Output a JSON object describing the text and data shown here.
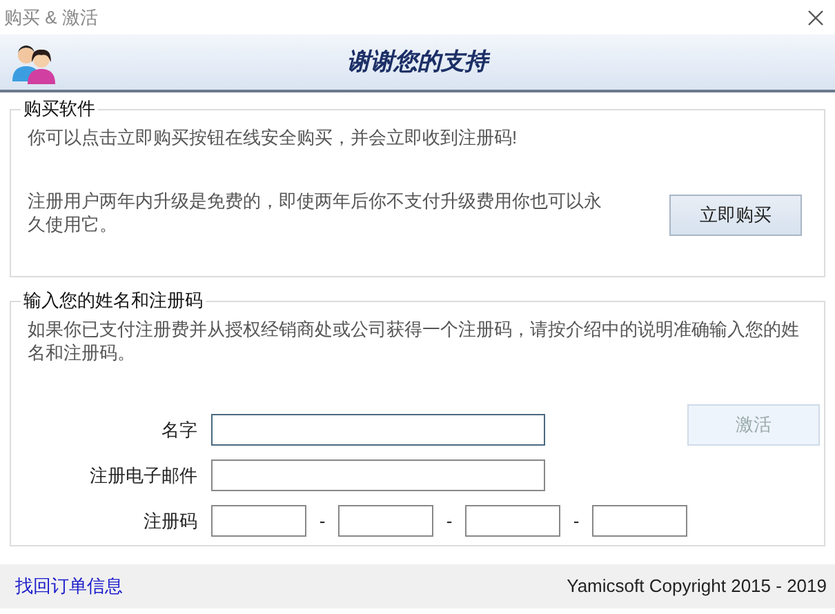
{
  "window": {
    "title": "购买 & 激活"
  },
  "header": {
    "title": "谢谢您的支持"
  },
  "buy_group": {
    "legend": "购买软件",
    "text_1": "你可以点击立即购买按钮在线安全购买，并会立即收到注册码!",
    "text_2": "注册用户两年内升级是免费的，即使两年后你不支付升级费用你也可以永久使用它。",
    "button": "立即购买"
  },
  "register_group": {
    "legend": "输入您的姓名和注册码",
    "text": "如果你已支付注册费并从授权经销商处或公司获得一个注册码，请按介绍中的说明准确输入您的姓名和注册码。",
    "fields": [
      {
        "label": "名字",
        "focused": true
      },
      {
        "label": "注册电子邮件",
        "focused": false
      }
    ],
    "code": {
      "label": "注册码",
      "segments": [
        {
          "focused": false
        },
        {
          "focused": false
        },
        {
          "focused": false
        },
        {
          "focused": false
        }
      ],
      "separators": [
        "-",
        "-",
        "-"
      ]
    },
    "activate_button": {
      "label": "激活",
      "disabled": true
    }
  },
  "footer": {
    "link": "找回订单信息",
    "copyright": "Yamicsoft Copyright 2015 - 2019"
  }
}
